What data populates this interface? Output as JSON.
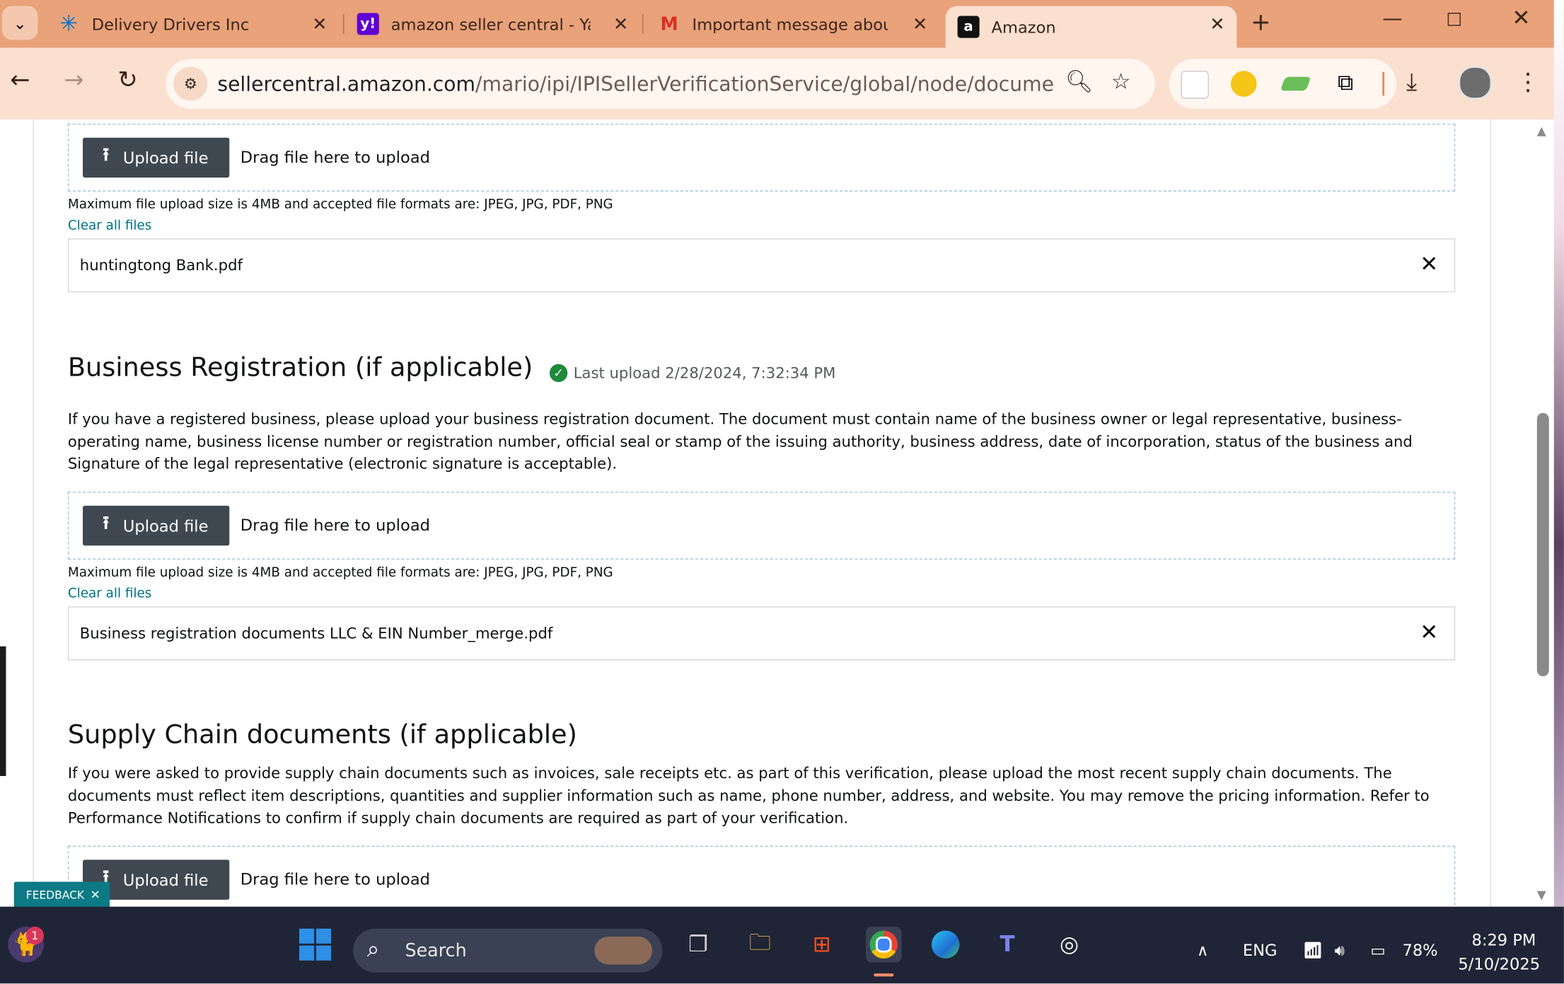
{
  "tabs": [
    {
      "title": "Delivery Drivers Inc",
      "favicon": "walmart-spark-icon",
      "color": "#0071ce"
    },
    {
      "title": "amazon seller central - Yah",
      "favicon": "yahoo-icon",
      "color": "#6001d2"
    },
    {
      "title": "Important message about",
      "favicon": "gmail-icon",
      "color": "#d93025"
    },
    {
      "title": "Amazon",
      "favicon": "amazon-icon",
      "color": "#111111"
    }
  ],
  "omnibox": {
    "domain": "sellercentral.amazon.com",
    "path": "/mario/ipi/IPISellerVerificationService/global/node/documentUpload/r..."
  },
  "sections": {
    "bank": {
      "upload_label": "Upload file",
      "drag_text": "Drag file here to upload",
      "note": "Maximum file upload size is 4MB and accepted file formats are: JPEG, JPG, PDF, PNG",
      "clear": "Clear all files",
      "file": "huntingtong Bank.pdf"
    },
    "business": {
      "title": "Business Registration (if applicable)",
      "last_upload": "Last upload 2/28/2024, 7:32:34 PM",
      "description": "If you have a registered business, please upload your business registration document. The document must contain name of the business owner or legal representative, business-operating name, business license number or registration number, official seal or stamp of the issuing authority, business address, date of incorporation, status of the business and Signature of the legal representative (electronic signature is acceptable).",
      "upload_label": "Upload file",
      "drag_text": "Drag file here to upload",
      "note": "Maximum file upload size is 4MB and accepted file formats are: JPEG, JPG, PDF, PNG",
      "clear": "Clear all files",
      "file": "Business registration documents LLC & EIN Number_merge.pdf"
    },
    "supply": {
      "title": "Supply Chain documents (if applicable)",
      "description": "If you were asked to provide supply chain documents such as invoices, sale receipts etc. as part of this verification, please upload the most recent supply chain documents. The documents must reflect item descriptions, quantities and supplier information such as name, phone number, address, and website. You may remove the pricing information. Refer to Performance Notifications to confirm if supply chain documents are required as part of your verification.",
      "upload_label": "Upload file",
      "drag_text": "Drag file here to upload"
    }
  },
  "feedback_label": "FEEDBACK",
  "taskbar": {
    "search_label": "Search",
    "language": "ENG",
    "battery": "78%",
    "time": "8:29 PM",
    "date": "5/10/2025",
    "notification_count": "1"
  }
}
